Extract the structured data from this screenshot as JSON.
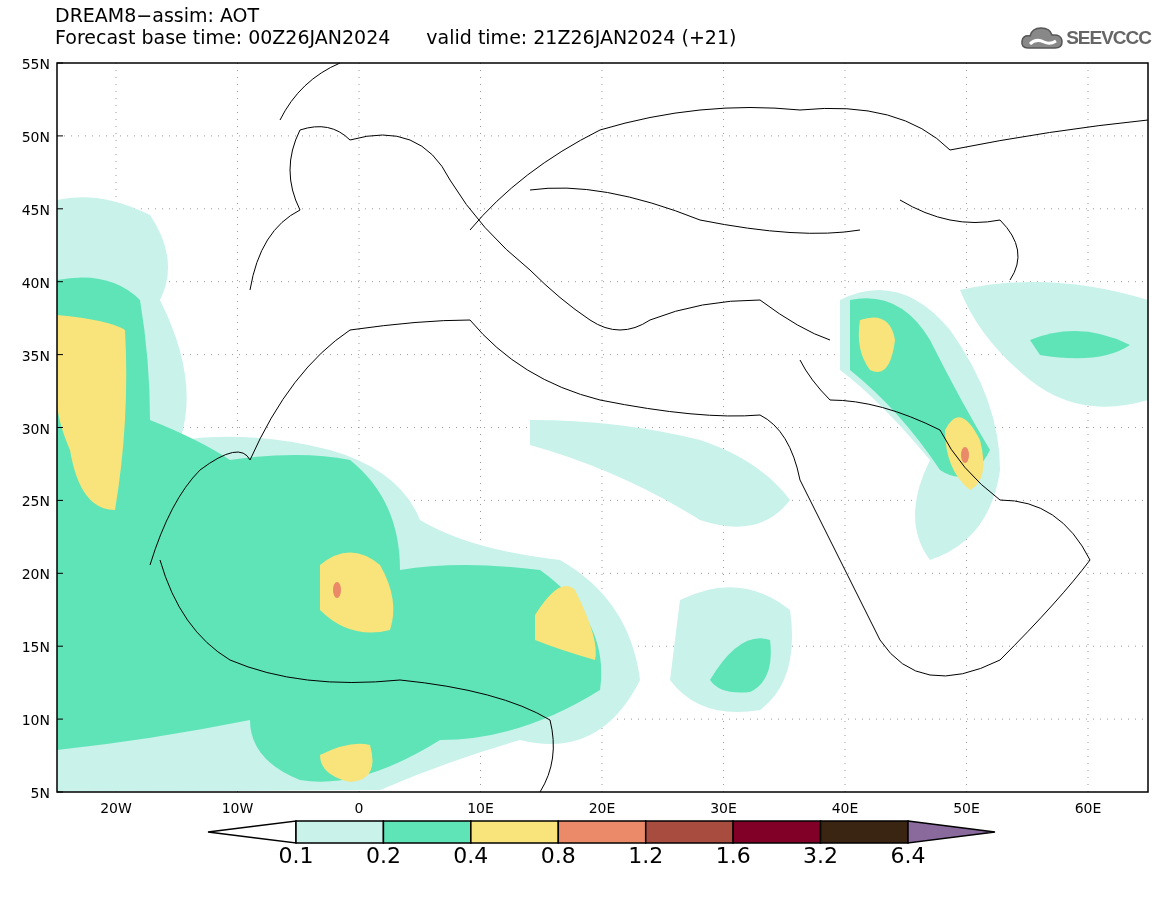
{
  "header": {
    "title": "DREAM8−assim: AOT",
    "base_time": "Forecast base time: 00Z26JAN2024",
    "valid_time": "valid time: 21Z26JAN2024 (+21)"
  },
  "logo": {
    "text": "SEEVCCC"
  },
  "map": {
    "y_labels": [
      "55N",
      "50N",
      "45N",
      "40N",
      "35N",
      "30N",
      "25N",
      "20N",
      "15N",
      "10N",
      "5N"
    ],
    "x_labels": [
      "20W",
      "10W",
      "0",
      "10E",
      "20E",
      "30E",
      "40E",
      "50E",
      "60E"
    ]
  },
  "colorbar": {
    "segments": [
      {
        "kind": "low",
        "color": "#ffffff"
      },
      {
        "kind": "band",
        "color": "#c8f2ea"
      },
      {
        "kind": "band",
        "color": "#5ee4b6"
      },
      {
        "kind": "band",
        "color": "#f8e47a"
      },
      {
        "kind": "band",
        "color": "#ea8a68"
      },
      {
        "kind": "band",
        "color": "#a84c40"
      },
      {
        "kind": "band",
        "color": "#800028"
      },
      {
        "kind": "band",
        "color": "#3a2412"
      },
      {
        "kind": "high",
        "color": "#8a6a9c"
      }
    ],
    "labels": [
      "0.1",
      "0.2",
      "0.4",
      "0.8",
      "1.2",
      "1.6",
      "3.2",
      "6.4"
    ]
  }
}
